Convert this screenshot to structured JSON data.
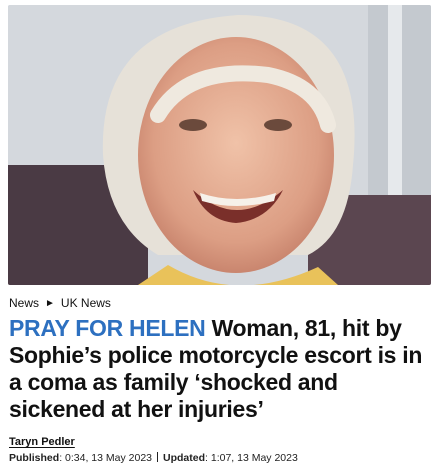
{
  "hero_image": {
    "caption": ""
  },
  "breadcrumb": {
    "items": [
      {
        "label": "News"
      },
      {
        "label": "UK News"
      }
    ]
  },
  "article": {
    "kicker": "PRAY FOR HELEN",
    "headline": "Woman, 81, hit by Sophie’s police motorcycle escort is in a coma as family ‘shocked and sickened at her injuries’",
    "author": "Taryn Pedler",
    "published_label": "Published",
    "published_value": ": 0:34, 13 May 2023",
    "updated_label": "Updated",
    "updated_value": ": 1:07, 13 May 2023"
  },
  "colors": {
    "kicker": "#2d70c0"
  }
}
